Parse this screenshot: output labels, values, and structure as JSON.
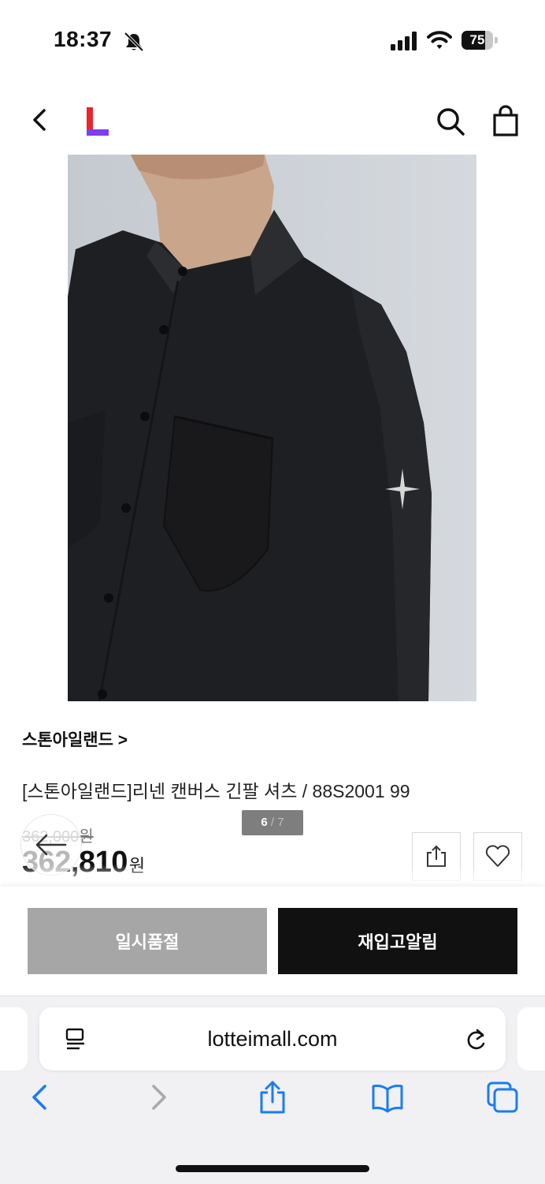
{
  "status_bar": {
    "time": "18:37",
    "battery": "75",
    "battery_level": 0.75
  },
  "top_nav": {
    "logo_colors": [
      "#e8262d",
      "#7b3ff2"
    ]
  },
  "gallery": {
    "current": "6",
    "separator": "/",
    "total": "7"
  },
  "product": {
    "brand_link": "스톤아일랜드 >",
    "title": "[스톤아일랜드]리넨 캔버스 긴팔 셔츠 / 88S2001 99",
    "original_price": "362,000원",
    "sale_price": "362,810",
    "sale_unit": "원"
  },
  "actions": {
    "soldout_label": "일시품절",
    "restock_label": "재입고알림"
  },
  "browser": {
    "url": "lotteimall.com"
  },
  "colors": {
    "accent_blue": "#1a7cf5",
    "disabled_gray": "#a6a6a6",
    "black_button": "#111111"
  },
  "icons": [
    "bell-slash-icon",
    "signal-icon",
    "wifi-icon",
    "back-chevron-icon",
    "search-icon",
    "shopping-bag-icon",
    "arrow-left-icon",
    "share-icon",
    "heart-icon",
    "reader-mode-icon",
    "reload-icon",
    "safari-back-icon",
    "safari-forward-icon",
    "safari-share-icon",
    "bookmarks-icon",
    "tabs-icon"
  ]
}
